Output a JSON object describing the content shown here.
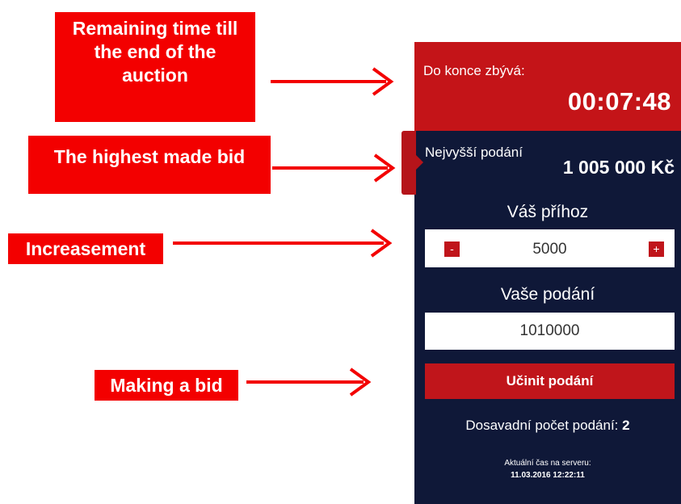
{
  "annotations": {
    "remaining_time": "Remaining time till the end of the auction",
    "highest_bid": "The highest made bid",
    "increasement": "Increasement",
    "making_bid": "Making a bid"
  },
  "auction": {
    "timer_label": "Do konce zbývá:",
    "timer_value": "00:07:48",
    "highest_bid_label": "Nejvyšší podání",
    "highest_bid_value": "1 005 000 Kč",
    "increment_label": "Váš příhoz",
    "decrement_symbol": "-",
    "increment_symbol": "+",
    "increment_value": "5000",
    "bid_label": "Vaše podání",
    "bid_value": "1010000",
    "submit_label": "Učinit podání",
    "bid_count_label": "Dosavadní počet podání:",
    "bid_count": "2",
    "server_time_label": "Aktuální čas na serveru:",
    "server_time": "11.03.2016 12:22:11"
  },
  "colors": {
    "annotation_red": "#f30000",
    "panel_navy": "#0f1838",
    "accent_red": "#c0151b"
  }
}
